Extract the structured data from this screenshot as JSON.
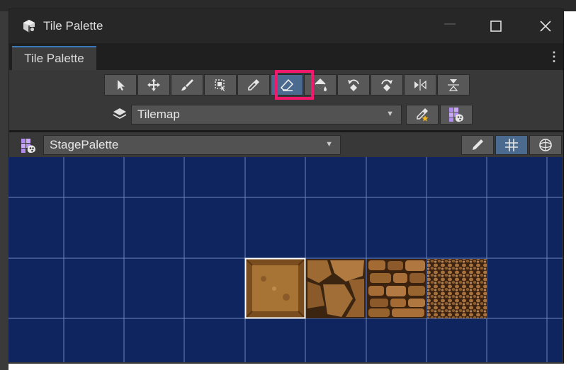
{
  "window": {
    "title": "Tile Palette",
    "minimize_glyph": "—"
  },
  "tab": {
    "label": "Tile Palette",
    "menu_glyph": "⋮"
  },
  "toolbar": {
    "tools": [
      {
        "name": "select",
        "icon": "arrow-select-icon"
      },
      {
        "name": "move",
        "icon": "move-icon"
      },
      {
        "name": "paint",
        "icon": "paintbrush-icon"
      },
      {
        "name": "box-fill",
        "icon": "box-fill-icon"
      },
      {
        "name": "pick",
        "icon": "eyedropper-icon"
      },
      {
        "name": "erase",
        "icon": "eraser-icon",
        "active": true
      },
      {
        "name": "fill",
        "icon": "paint-bucket-icon"
      },
      {
        "name": "rotate-counterclockwise",
        "icon": "rotate-left-icon"
      },
      {
        "name": "rotate-clockwise",
        "icon": "rotate-right-icon"
      },
      {
        "name": "flip-x",
        "icon": "flip-horizontal-icon"
      },
      {
        "name": "flip-y",
        "icon": "flip-vertical-icon"
      }
    ],
    "highlight_color": "#f0196e"
  },
  "target": {
    "selected": "Tilemap",
    "layers_icon": "layers-icon",
    "buttons": [
      "eyedropper-star-icon",
      "palette-icon"
    ]
  },
  "palette": {
    "selected": "StagePalette",
    "icon": "palette-icon",
    "view_buttons": [
      {
        "name": "edit",
        "icon": "pencil-icon",
        "active": false
      },
      {
        "name": "grid",
        "icon": "grid-icon",
        "active": true
      },
      {
        "name": "gizmos",
        "icon": "gizmo-globe-icon",
        "active": false
      }
    ]
  },
  "canvas": {
    "background": "#0f255f",
    "tiles": [
      {
        "name": "dirt-tile",
        "selected": true
      },
      {
        "name": "large-stone-tile",
        "selected": false
      },
      {
        "name": "brick-stone-tile",
        "selected": false
      },
      {
        "name": "pebble-tile",
        "selected": false
      }
    ]
  },
  "colors": {
    "accent": "#3a79bb",
    "active_tool": "#4a6a8f",
    "panel": "#383838",
    "titlebar": "#272727"
  }
}
